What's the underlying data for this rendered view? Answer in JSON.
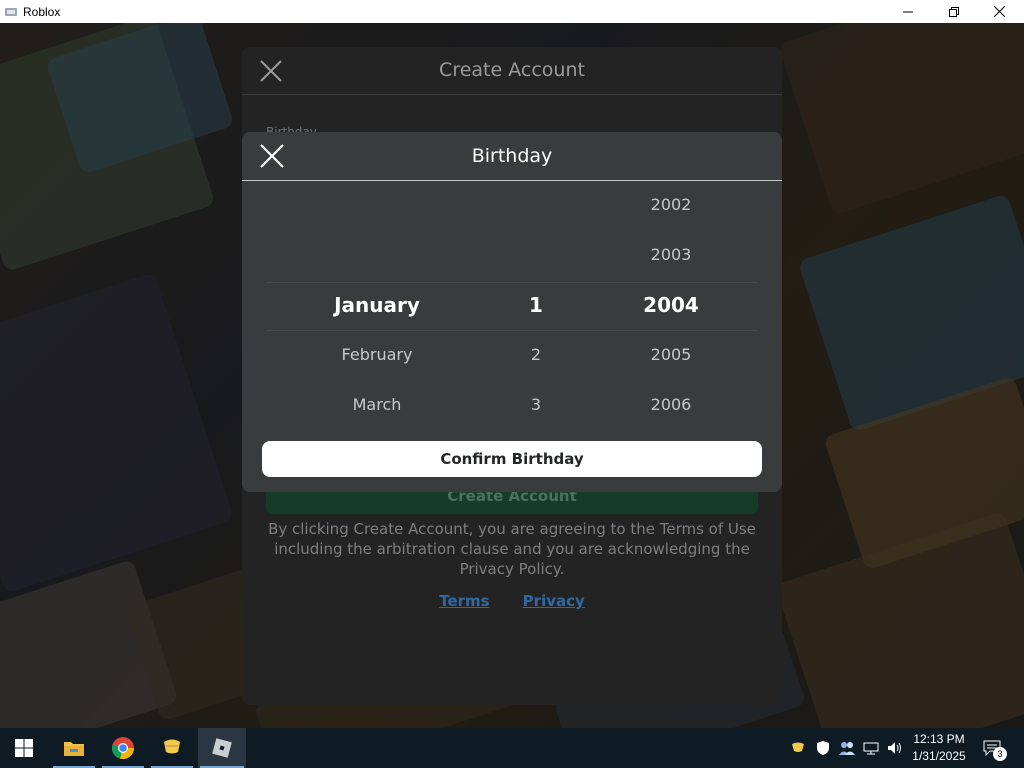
{
  "window": {
    "title": "Roblox"
  },
  "create_account": {
    "title": "Create Account",
    "birthday_label": "Birthday",
    "create_button": "Create Account",
    "terms_text": "By clicking Create Account, you are agreeing to the Terms of Use including the arbitration clause and you are acknowledging the Privacy Policy.",
    "terms_link": "Terms",
    "privacy_link": "Privacy"
  },
  "birthday_modal": {
    "title": "Birthday",
    "months": {
      "selected": "January",
      "after": [
        "February",
        "March"
      ]
    },
    "days": {
      "selected": "1",
      "after": [
        "2",
        "3"
      ]
    },
    "years": {
      "before": [
        "2002",
        "2003"
      ],
      "selected": "2004",
      "after": [
        "2005",
        "2006"
      ]
    },
    "confirm_button": "Confirm Birthday"
  },
  "taskbar": {
    "apps": [
      "start-icon",
      "file-explorer-icon",
      "chrome-icon",
      "notes-icon",
      "roblox-icon"
    ],
    "clock_time": "12:13 PM",
    "clock_date": "1/31/2025",
    "notification_count": "3"
  },
  "colors": {
    "modal_bg": "#393b3d",
    "panel_bg": "#2b2b2c",
    "link": "#3a7fc6",
    "create_btn": "#1c4a33"
  }
}
